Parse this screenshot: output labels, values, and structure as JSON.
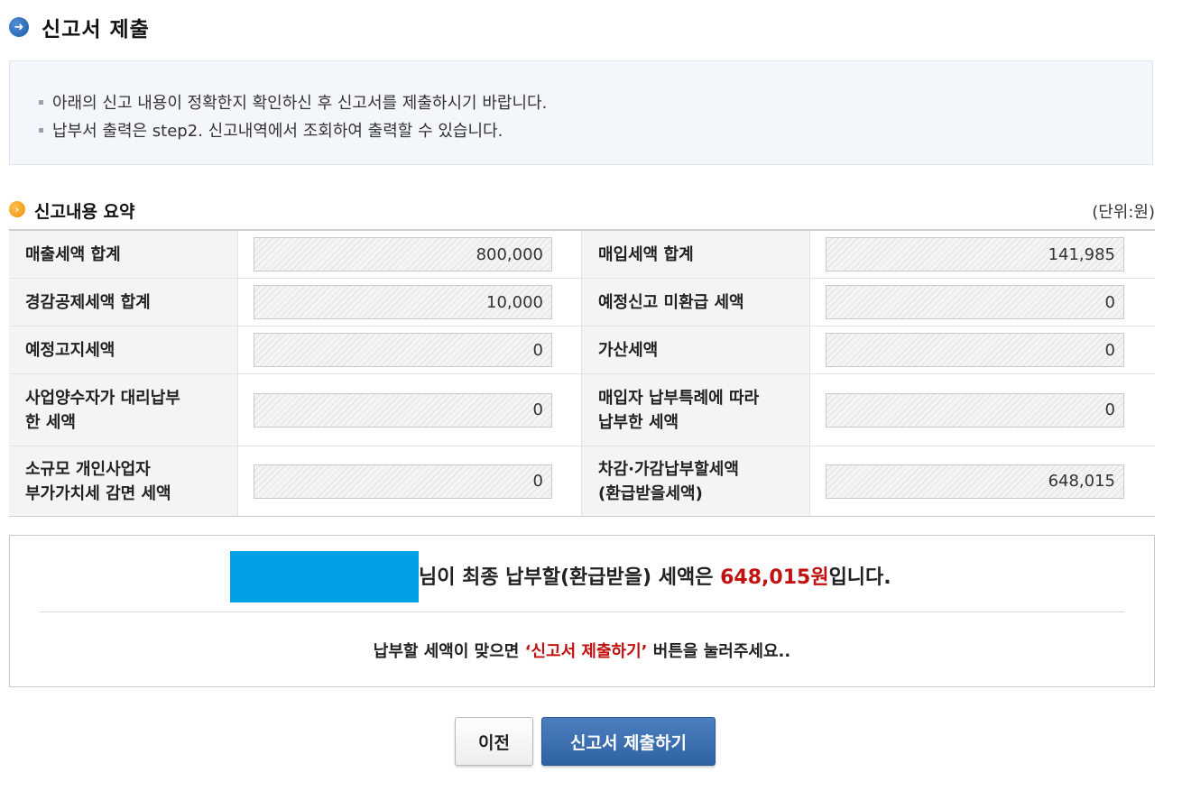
{
  "page": {
    "title": "신고서 제출",
    "title_icon": "arrow-right-circle-icon"
  },
  "notice": {
    "lines": [
      "아래의 신고 내용이 정확한지 확인하신 후 신고서를 제출하시기 바랍니다.",
      "납부서 출력은 step2. 신고내역에서 조회하여 출력할 수 있습니다."
    ]
  },
  "summary": {
    "title": "신고내용 요약",
    "title_icon": "chevron-right-circle-icon",
    "unit": "(단위:원)",
    "rows": [
      {
        "left_label": "매출세액 합계",
        "left_value": "800,000",
        "right_label": "매입세액 합계",
        "right_value": "141,985"
      },
      {
        "left_label": "경감공제세액 합계",
        "left_value": "10,000",
        "right_label": "예정신고 미환급 세액",
        "right_value": "0"
      },
      {
        "left_label": "예정고지세액",
        "left_value": "0",
        "right_label": "가산세액",
        "right_value": "0"
      },
      {
        "left_label": "사업양수자가 대리납부\n한 세액",
        "left_value": "0",
        "right_label": "매입자 납부특례에 따라\n납부한 세액",
        "right_value": "0"
      },
      {
        "left_label": "소규모 개인사업자\n부가가치세 감면 세액",
        "left_value": "0",
        "right_label": "차감·가감납부할세액\n(환급받을세액)",
        "right_value": "648,015"
      }
    ]
  },
  "result": {
    "prefix": "님이 최종 납부할(환급받을) 세액은 ",
    "amount": "648,015원",
    "suffix": "입니다.",
    "note_prefix": "납부할 세액이 맞으면 ",
    "note_highlight": "‘신고서 제출하기’",
    "note_suffix": " 버튼을 눌러주세요..",
    "redaction_color": "#00a2e6",
    "amount_color": "#c0100f"
  },
  "buttons": {
    "prev": "이전",
    "submit": "신고서 제출하기",
    "submit_color": "#2f62a3"
  }
}
